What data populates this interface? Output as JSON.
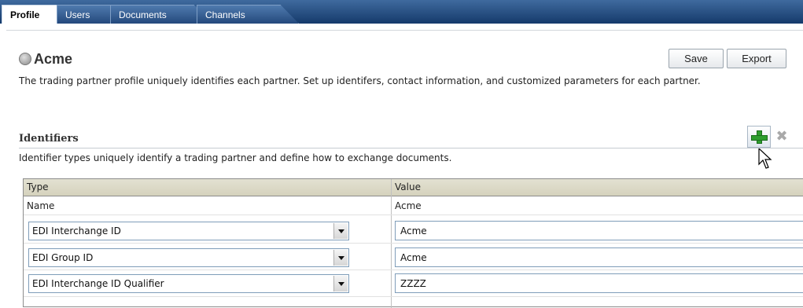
{
  "tabs": [
    {
      "label": "Profile",
      "active": true
    },
    {
      "label": "Users",
      "active": false
    },
    {
      "label": "Documents",
      "active": false
    },
    {
      "label": "Channels",
      "active": false
    }
  ],
  "header": {
    "title": "Acme",
    "save_label": "Save",
    "export_label": "Export",
    "description": "The trading partner profile uniquely identifies each partner. Set up identifers, contact information, and customized parameters for each partner."
  },
  "identifiers": {
    "title": "Identifiers",
    "description": "Identifier types uniquely identify a trading partner and define how to exchange documents.",
    "add_icon": "plus-icon",
    "delete_icon": "delete-x-icon",
    "columns": {
      "type": "Type",
      "value": "Value"
    },
    "rows": [
      {
        "type": "Name",
        "value": "Acme",
        "editable": false
      },
      {
        "type": "EDI Interchange ID",
        "value": "Acme",
        "editable": true
      },
      {
        "type": "EDI Group ID",
        "value": "Acme",
        "editable": true
      },
      {
        "type": "EDI Interchange ID Qualifier",
        "value": "ZZZZ",
        "editable": true
      }
    ]
  },
  "colors": {
    "tab_bar": "#1d4478",
    "table_header": "#d9d6c3",
    "add_icon": "#2e9e2e"
  }
}
